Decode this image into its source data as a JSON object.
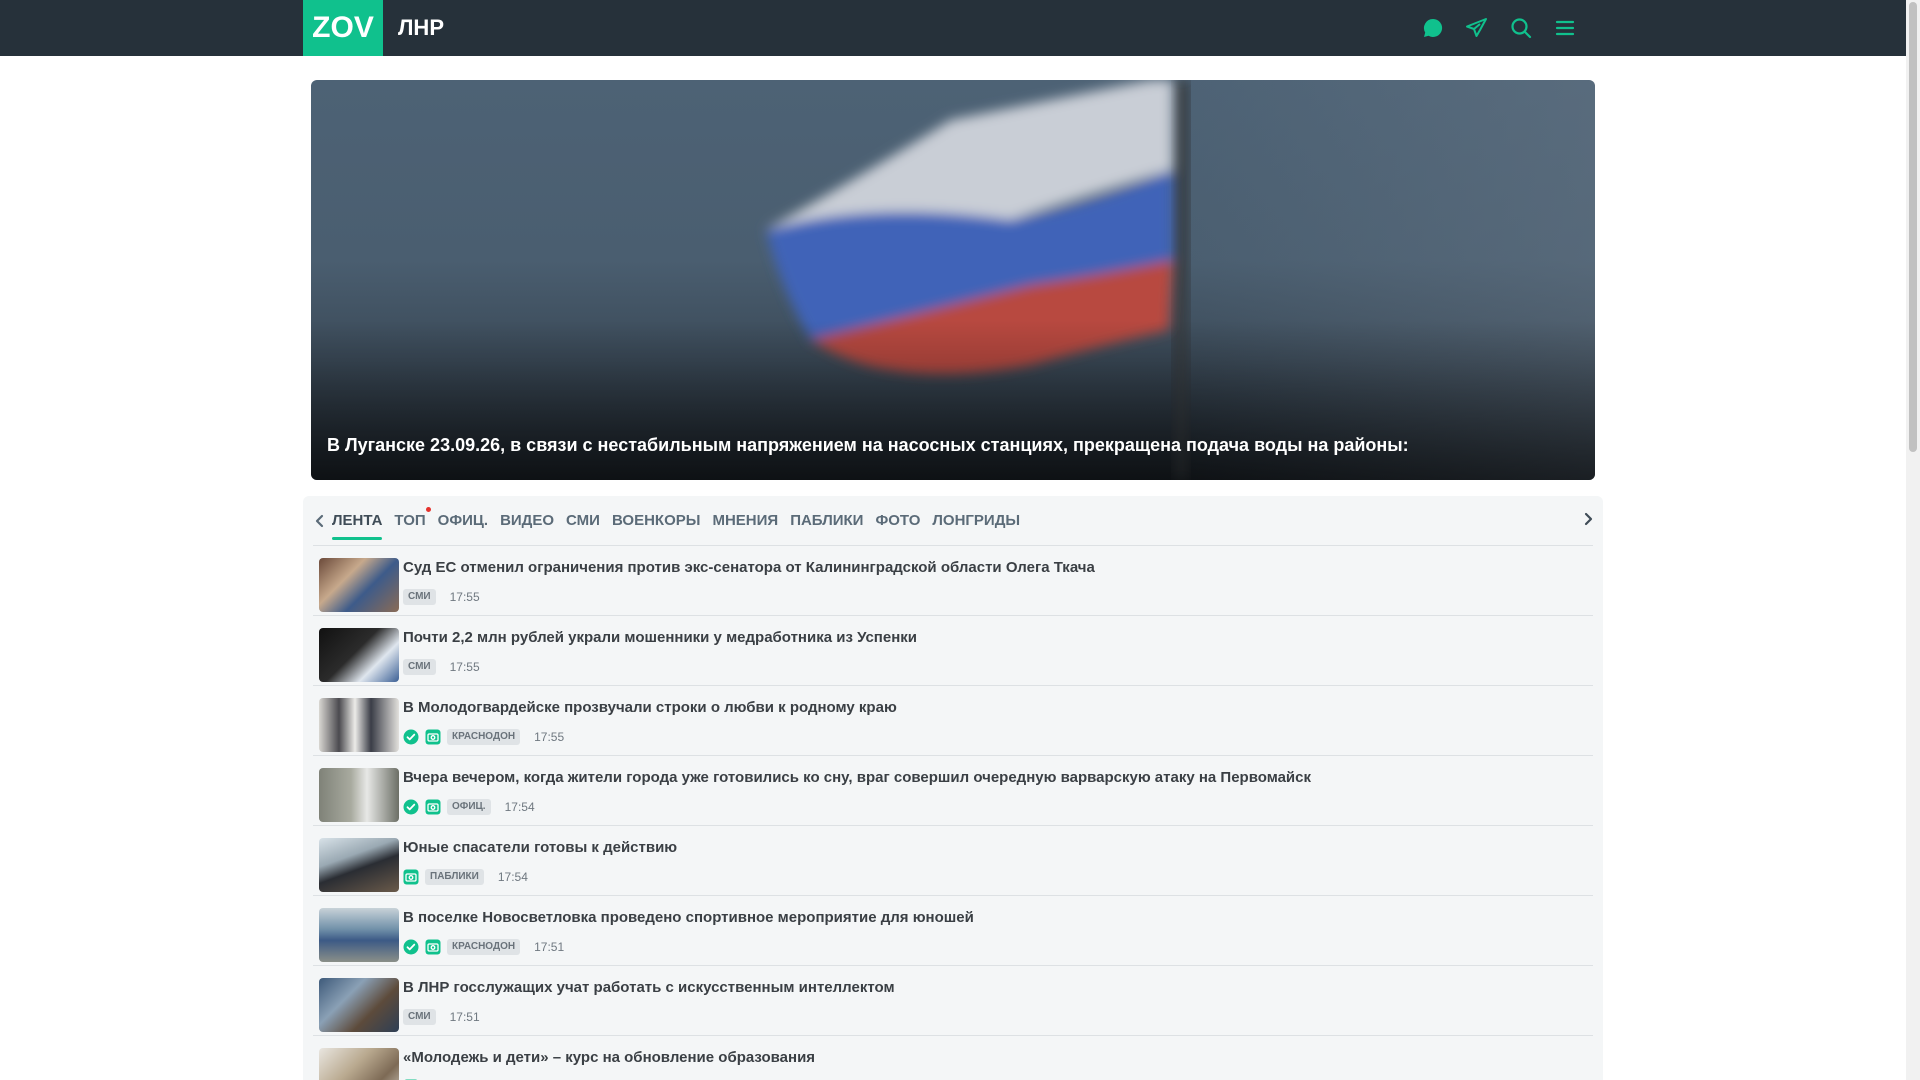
{
  "header": {
    "logo": "ZOV",
    "region": "ЛНР",
    "icons": [
      "chat-icon",
      "telegram-icon",
      "search-icon",
      "menu-icon"
    ]
  },
  "hero": {
    "title": "В Луганске 23.09.26, в связи с нестабильным напряжением на насосных станциях, прекращена подача воды на районы:"
  },
  "tabs": [
    {
      "label": "ЛЕНТА",
      "active": true
    },
    {
      "label": "ТОП",
      "dot": true
    },
    {
      "label": "ОФИЦ."
    },
    {
      "label": "ВИДЕО"
    },
    {
      "label": "СМИ"
    },
    {
      "label": "ВОЕНКОРЫ"
    },
    {
      "label": "МНЕНИЯ"
    },
    {
      "label": "ПАБЛИКИ"
    },
    {
      "label": "ФОТО"
    },
    {
      "label": "ЛОНГРИДЫ"
    }
  ],
  "feed": [
    {
      "title": "Суд ЕС отменил ограничения против экс-сенатора от Калининградской области Олега Ткача",
      "verified": false,
      "photo": false,
      "source": "СМИ",
      "time": "17:55"
    },
    {
      "title": "Почти 2,2 млн рублей украли мошенники у медработника из Успенки",
      "verified": false,
      "photo": false,
      "source": "СМИ",
      "time": "17:55"
    },
    {
      "title": "В Молодогвардейске прозвучали строки о любви к родному краю",
      "verified": true,
      "photo": true,
      "source": "КРАСНОДОН",
      "time": "17:55"
    },
    {
      "title": "Вчера вечером, когда жители города уже готовились ко сну, враг совершил очередную варварскую атаку на Первомайск",
      "verified": true,
      "photo": true,
      "source": "ОФИЦ.",
      "time": "17:54"
    },
    {
      "title": "Юные спасатели готовы к действию",
      "verified": false,
      "photo": true,
      "source": "ПАБЛИКИ",
      "time": "17:54"
    },
    {
      "title": "В поселке Новосветловка проведено спортивное мероприятие для юношей",
      "verified": true,
      "photo": true,
      "source": "КРАСНОДОН",
      "time": "17:51"
    },
    {
      "title": "В ЛНР госслужащих учат работать с искусственным интеллектом",
      "verified": false,
      "photo": false,
      "source": "СМИ",
      "time": "17:51"
    },
    {
      "title": "«Молодежь и дети» – курс на обновление образования",
      "verified": false,
      "photo": true,
      "source": "",
      "time": ""
    }
  ],
  "colors": {
    "accent": "#10c18d",
    "header": "#26313a",
    "alert": "#e5322d"
  }
}
